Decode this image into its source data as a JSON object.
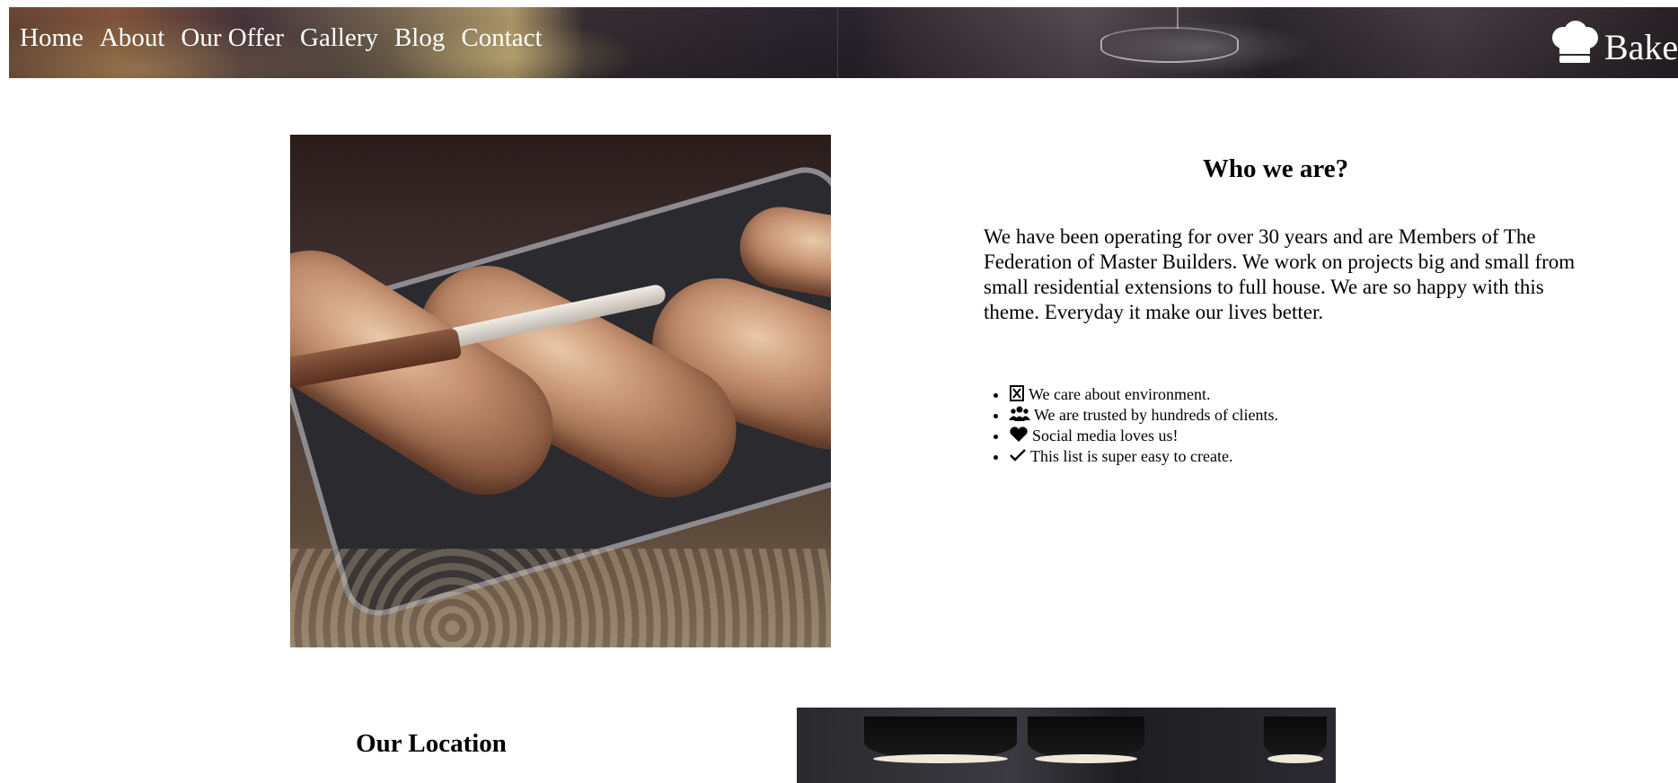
{
  "nav": {
    "items": [
      "Home",
      "About",
      "Our Offer",
      "Gallery",
      "Blog",
      "Contact"
    ]
  },
  "brand": {
    "name": "Baker",
    "icon": "chef-hat-icon"
  },
  "about": {
    "title": "Who we are?",
    "text": "We have been operating for over 30 years and are Members of The Federation of Master Builders. We work on projects big and small from small residential extensions to full house. We are so happy with this theme. Everyday it make our lives better.",
    "features": [
      {
        "icon": "box-x-icon",
        "label": "We care about environment."
      },
      {
        "icon": "users-icon",
        "label": "We are trusted by hundreds of clients."
      },
      {
        "icon": "heart-icon",
        "label": "Social media loves us!"
      },
      {
        "icon": "check-icon",
        "label": "This list is super easy to create."
      }
    ]
  },
  "location": {
    "title": "Our Location"
  },
  "colors": {
    "text": "#000000",
    "nav_text": "#ffffff",
    "background": "#ffffff"
  }
}
